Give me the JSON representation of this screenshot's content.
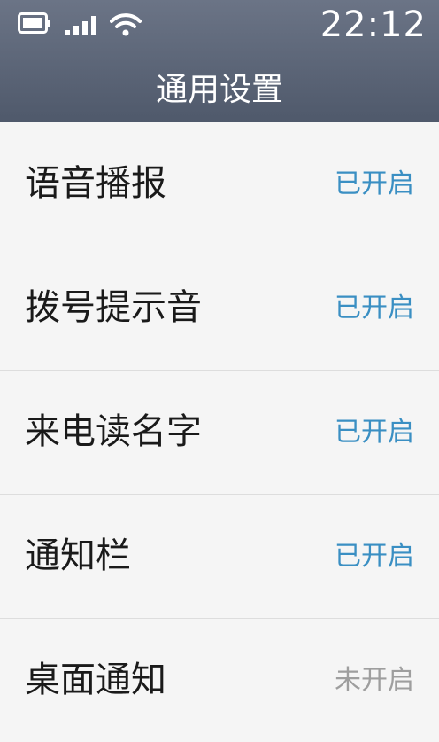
{
  "status_bar": {
    "time": "22:12",
    "icons": [
      "battery-icon",
      "signal-icon",
      "wifi-icon"
    ]
  },
  "header": {
    "title": "通用设置"
  },
  "colors": {
    "header": "#56606f",
    "status_on": "#3a8fc3",
    "status_off": "#9e9e9e"
  },
  "settings": [
    {
      "label": "语音播报",
      "status": "已开启",
      "enabled": true
    },
    {
      "label": "拨号提示音",
      "status": "已开启",
      "enabled": true
    },
    {
      "label": "来电读名字",
      "status": "已开启",
      "enabled": true
    },
    {
      "label": "通知栏",
      "status": "已开启",
      "enabled": true
    },
    {
      "label": "桌面通知",
      "status": "未开启",
      "enabled": false
    }
  ]
}
